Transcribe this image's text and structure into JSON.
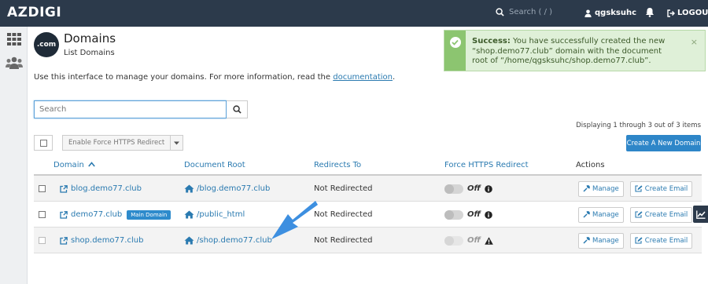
{
  "topbar": {
    "logo": "AZDIGI",
    "search_placeholder": "Search ( / )",
    "username": "qgsksuhc",
    "logout_label": "LOGOUT"
  },
  "header": {
    "icon_text": ".com",
    "title": "Domains",
    "subtitle": "List Domains"
  },
  "alert": {
    "strong": "Success:",
    "message": " You have successfully created the new “shop.demo77.club” domain with the document root of “/home/qgsksuhc/shop.demo77.club”.",
    "close": "×"
  },
  "intro": {
    "text": "Use this interface to manage your domains. For more information, read the ",
    "link": "documentation",
    "suffix": "."
  },
  "search": {
    "placeholder": "Search"
  },
  "displaying": "Displaying 1 through 3 out of 3 items",
  "toolbar": {
    "https_label": "Enable Force HTTPS Redirect",
    "create_label": "Create A New Domain"
  },
  "table": {
    "headers": {
      "domain": "Domain",
      "docroot": "Document Root",
      "redirects": "Redirects To",
      "https": "Force HTTPS Redirect",
      "actions": "Actions"
    },
    "rows": [
      {
        "domain": "blog.demo77.club",
        "badge": "",
        "docroot": "/blog.demo77.club",
        "redirect": "Not Redirected",
        "https": "Off",
        "manage": "Manage",
        "email": "Create Email"
      },
      {
        "domain": "demo77.club",
        "badge": "Main Domain",
        "docroot": "/public_html",
        "redirect": "Not Redirected",
        "https": "Off",
        "manage": "Manage",
        "email": "Create Email"
      },
      {
        "domain": "shop.demo77.club",
        "badge": "",
        "docroot": "/shop.demo77.club",
        "redirect": "Not Redirected",
        "https": "Off",
        "manage": "Manage",
        "email": "Create Email"
      }
    ]
  },
  "colors": {
    "topbar": "#2c3a4b",
    "accent": "#2e86c8",
    "success_bg": "#dff0d8",
    "arrow": "#3d8fe0"
  }
}
